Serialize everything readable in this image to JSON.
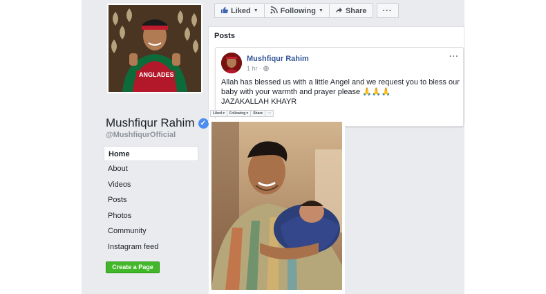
{
  "profile": {
    "name": "Mushfiqur Rahim",
    "handle": "@MushfiqurOfficial",
    "verified_icon": "verified-badge-icon",
    "jersey_text": "ANGLADES"
  },
  "nav": {
    "items": [
      {
        "label": "Home",
        "active": true
      },
      {
        "label": "About"
      },
      {
        "label": "Videos"
      },
      {
        "label": "Posts"
      },
      {
        "label": "Photos"
      },
      {
        "label": "Community"
      },
      {
        "label": "Instagram feed"
      }
    ],
    "create_page": "Create a Page"
  },
  "toolbar": {
    "liked": "Liked",
    "following": "Following",
    "share": "Share",
    "more": "···"
  },
  "posts_section": {
    "title": "Posts"
  },
  "post": {
    "author": "Mushfiqur Rahim",
    "time": "1 hr ·",
    "more": "···",
    "text": "Allah has blessed us with a little Angel and we request you to bless our baby with your warmth and prayer please 🙏🙏🙏",
    "text2": "JAZAKALLAH KHAYR"
  },
  "mini_toolbar": {
    "liked": "Liked ▾",
    "following": "Following ▾",
    "share": "Share",
    "more": "···"
  },
  "colors": {
    "accent": "#365899",
    "verified": "#4b8ef0",
    "create_button": "#42b72a",
    "background": "#e9ebee"
  }
}
